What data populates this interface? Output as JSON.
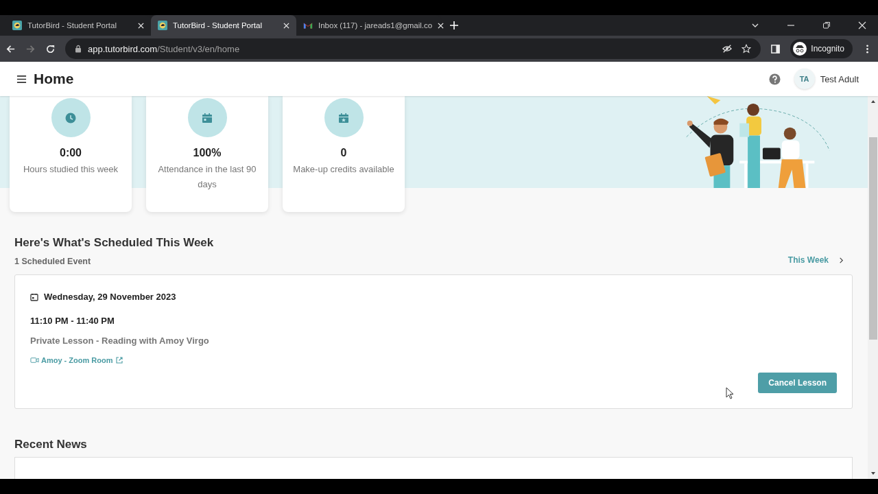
{
  "browser": {
    "tabs": [
      {
        "title": "TutorBird - Student Portal",
        "selected": false
      },
      {
        "title": "TutorBird - Student Portal",
        "selected": true
      },
      {
        "title": "Inbox (117) - jareads1@gmail.co",
        "selected": false
      }
    ],
    "url_host": "app.tutorbird.com",
    "url_path": "/Student/v3/en/home",
    "profile": "Incognito"
  },
  "header": {
    "title": "Home",
    "avatar_initials": "TA",
    "user_name": "Test Adult"
  },
  "stats": [
    {
      "value": "0:00",
      "label": "Hours studied this week"
    },
    {
      "value": "100%",
      "label": "Attendance in the last 90 days"
    },
    {
      "value": "0",
      "label": "Make-up credits available"
    }
  ],
  "schedule": {
    "title": "Here's What's Scheduled This Week",
    "count": "1 Scheduled Event",
    "range_link": "This Week",
    "events": [
      {
        "date": "Wednesday, 29 November 2023",
        "time": "11:10 PM - 11:40 PM",
        "title": "Private Lesson - Reading with Amoy Virgo",
        "room_link": "Amoy - Zoom Room",
        "action": "Cancel Lesson"
      }
    ]
  },
  "news": {
    "title": "Recent News"
  }
}
